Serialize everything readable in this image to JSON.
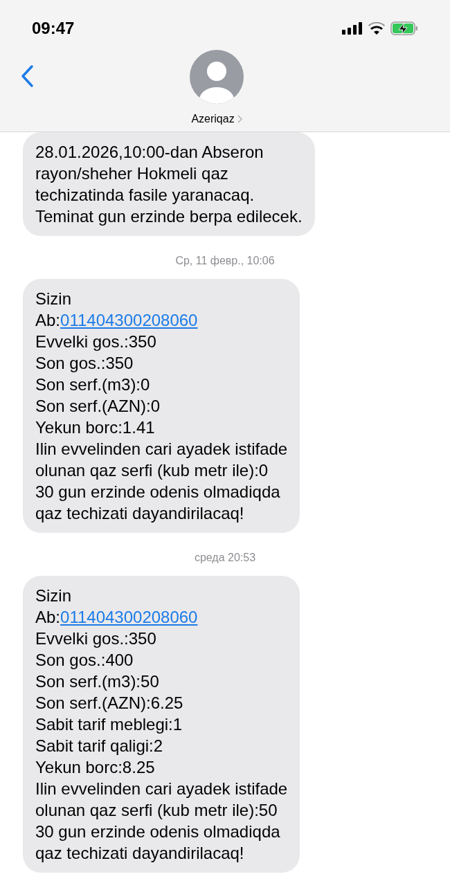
{
  "status_bar": {
    "time": "09:47",
    "battery_charging": true
  },
  "header": {
    "contact_name": "Azeriqaz"
  },
  "messages": [
    {
      "kind": "bubble",
      "lines": [
        {
          "text": "28.01.2026,10:00-dan Abseron"
        },
        {
          "text": "rayon/sheher Hokmeli qaz"
        },
        {
          "text": "techizatinda fasile yaranacaq."
        },
        {
          "text": "Teminat gun erzinde berpa edilecek."
        }
      ]
    },
    {
      "kind": "timestamp",
      "text": "Ср, 11 февр., 10:06"
    },
    {
      "kind": "bubble",
      "lines": [
        {
          "text": "Sizin"
        },
        {
          "text": "Ab:",
          "link": "011404300208060"
        },
        {
          "text": "Evvelki gos.:350"
        },
        {
          "text": "Son gos.:350"
        },
        {
          "text": "Son serf.(m3):0"
        },
        {
          "text": "Son serf.(AZN):0"
        },
        {
          "text": "Yekun borc:1.41"
        },
        {
          "text": "Ilin evvelinden cari ayadek istifade"
        },
        {
          "text": "olunan qaz serfi (kub metr ile):0"
        },
        {
          "text": "30 gun erzinde odenis olmadiqda"
        },
        {
          "text": "qaz techizati dayandirilacaq!"
        }
      ]
    },
    {
      "kind": "timestamp",
      "text": "среда 20:53"
    },
    {
      "kind": "bubble",
      "lines": [
        {
          "text": "Sizin"
        },
        {
          "text": "Ab:",
          "link": "011404300208060"
        },
        {
          "text": "Evvelki gos.:350"
        },
        {
          "text": "Son gos.:400"
        },
        {
          "text": "Son serf.(m3):50"
        },
        {
          "text": "Son serf.(AZN):6.25"
        },
        {
          "text": "Sabit tarif meblegi:1"
        },
        {
          "text": "Sabit tarif qaligi:2"
        },
        {
          "text": "Yekun borc:8.25"
        },
        {
          "text": "Ilin evvelinden cari ayadek istifade"
        },
        {
          "text": "olunan qaz serfi (kub metr ile):50"
        },
        {
          "text": "30 gun erzinde odenis olmadiqda"
        },
        {
          "text": "qaz techizati dayandirilacaq!"
        }
      ]
    }
  ]
}
